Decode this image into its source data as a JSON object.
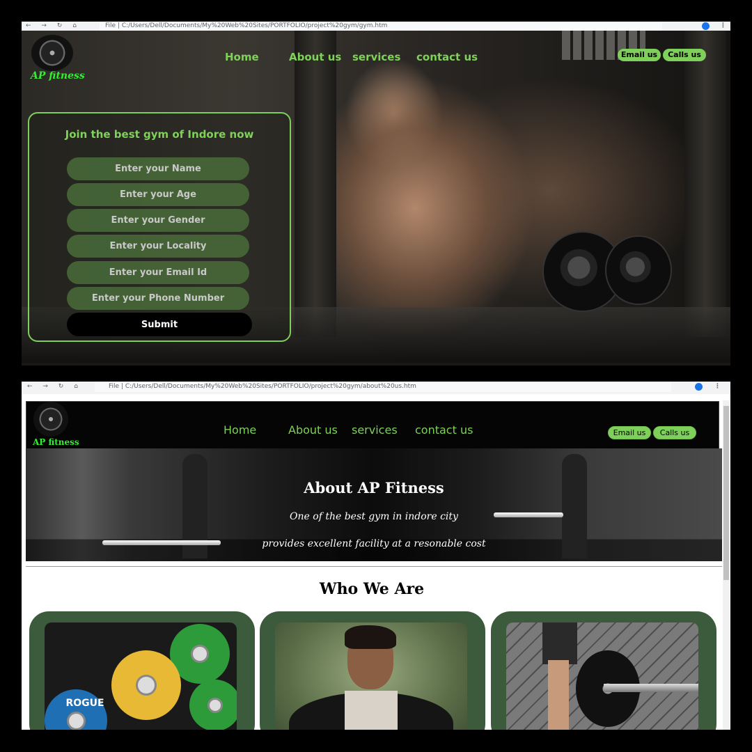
{
  "shot1": {
    "url": "File  |  C:/Users/Dell/Documents/My%20Web%20Sites/PORTFOLIO/project%20gym/gym.htm",
    "brand": "AP fitness",
    "nav": [
      "Home",
      "About us",
      "services",
      "contact us"
    ],
    "email_label": "Email us",
    "call_label": "Calls us",
    "form": {
      "title": "Join the best gym of Indore now",
      "fields": [
        "Enter your Name",
        "Enter your Age",
        "Enter your Gender",
        "Enter your Locality",
        "Enter your Email Id",
        "Enter your Phone Number"
      ],
      "submit_label": "Submit"
    }
  },
  "shot2": {
    "url": "File  |  C:/Users/Dell/Documents/My%20Web%20Sites/PORTFOLIO/project%20gym/about%20us.htm",
    "brand": "AP fitness",
    "nav": [
      "Home",
      "About us",
      "services",
      "contact us"
    ],
    "email_label": "Email us",
    "call_label": "Calls us",
    "banner": {
      "title": "About AP Fitness",
      "line1": "One of the best gym in indore city",
      "line2": "provides excellent facility at a resonable cost"
    },
    "section_title": "Who We Are",
    "card_plate_text": "ROGUE"
  },
  "colors": {
    "accent_green": "#7fcf5b",
    "card_green": "#3c5a3c",
    "brand_green": "#33ee33"
  },
  "icons": [
    "back-arrow-icon",
    "forward-arrow-icon",
    "reload-icon",
    "home-icon",
    "star-icon",
    "extension-icon",
    "menu-dots-icon",
    "dumbbell-plate-logo"
  ]
}
